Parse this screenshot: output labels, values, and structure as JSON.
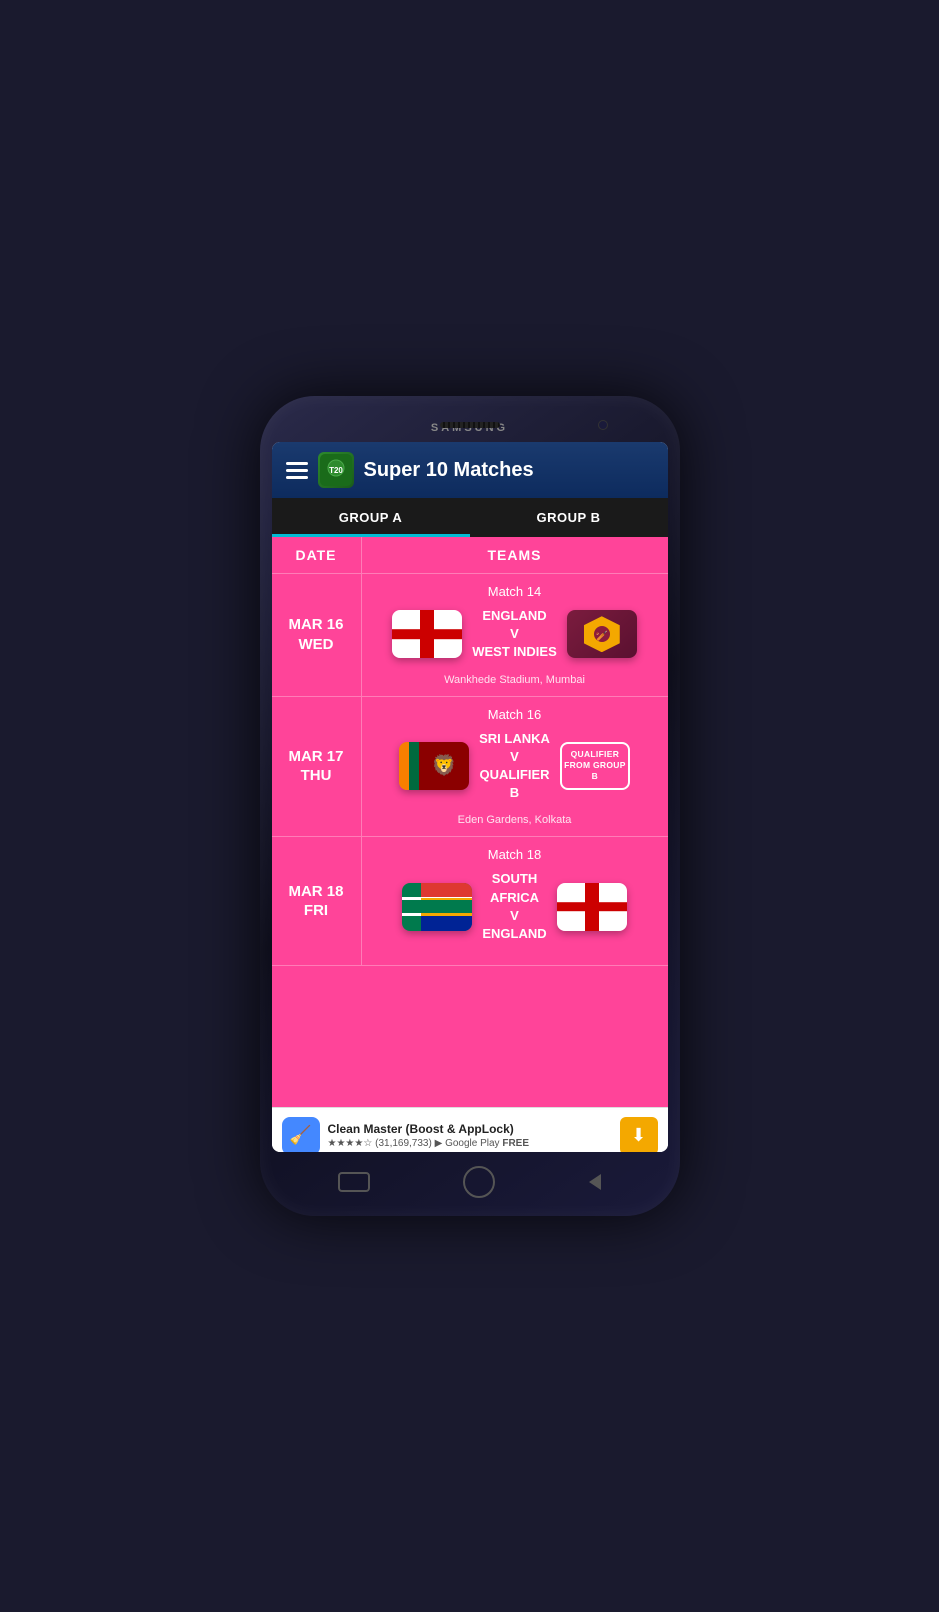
{
  "phone": {
    "brand": "SAMSUNG"
  },
  "app": {
    "title": "Super 10 Matches",
    "tabs": [
      {
        "id": "group-a",
        "label": "GROUP A",
        "active": true
      },
      {
        "id": "group-b",
        "label": "GROUP B",
        "active": false
      }
    ]
  },
  "table": {
    "headers": {
      "date": "DATE",
      "teams": "TEAMS"
    },
    "matches": [
      {
        "id": "match-14",
        "match_label": "Match 14",
        "date": "MAR 16",
        "day": "WED",
        "team1": "ENGLAND",
        "vs": "V",
        "team2": "WEST INDIES",
        "team1_flag": "england",
        "team2_flag": "westindies",
        "venue": "Wankhede Stadium, Mumbai"
      },
      {
        "id": "match-16",
        "match_label": "Match 16",
        "date": "MAR 17",
        "day": "THU",
        "team1": "SRI LANKA",
        "vs": "V",
        "team2": "QUALIFIER B",
        "team1_flag": "srilanka",
        "team2_flag": "qualifier",
        "qualifier_text": "QUALIFIER FROM GROUP B",
        "venue": "Eden Gardens, Kolkata"
      },
      {
        "id": "match-18",
        "match_label": "Match 18",
        "date": "MAR 18",
        "day": "FRI",
        "team1": "SOUTH AFRICA",
        "vs": "V",
        "team2": "ENGLAND",
        "team1_flag": "southafrica",
        "team2_flag": "england",
        "venue": ""
      }
    ]
  },
  "ad": {
    "title": "Clean Master (Boost & AppLock)",
    "rating_stars": "★★★★☆",
    "rating_count": "(31,169,733)",
    "store": "Google Play",
    "price": "FREE",
    "action": "⬇"
  }
}
